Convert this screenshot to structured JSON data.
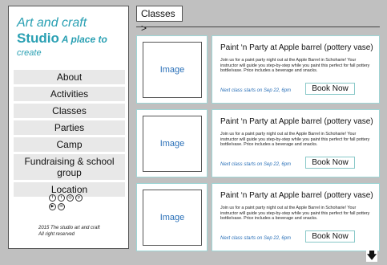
{
  "brand": {
    "line1": "Art and craft",
    "studio": "Studio",
    "tagline": "A place to",
    "tagline2": "create",
    "color": "#2aa0b3"
  },
  "nav": [
    "About",
    "Activities",
    "Classes",
    "Parties",
    "Camp",
    "Fundraising & school group",
    "Location"
  ],
  "social_icons": [
    "facebook-icon",
    "twitter-icon",
    "instagram-icon",
    "pinterest-icon",
    "youtube-icon",
    "email-icon"
  ],
  "footer": {
    "line1": "2015 The studio art and craft",
    "line2": "All right reserved"
  },
  "breadcrumb": "Classes >",
  "cards": [
    {
      "image": "Image",
      "title": "Paint ‘n Party at Apple barrel (pottery vase)",
      "description": "Join us for a paint party night out at the Apple Barrel in Schoharie! Your instructor will guide you step-by-step while you paint this perfect for fall pottery bottle/vase. Price includes a beverage and snacks.",
      "next": "Next class starts on Sep 22, 6pm",
      "button": "Book Now"
    },
    {
      "image": "Image",
      "title": "Paint ‘n Party at Apple barrel (pottery vase)",
      "description": "Join us for a paint party night out at the Apple Barrel in Schoharie! Your instructor will guide you step-by-step while you paint this perfect for fall pottery bottle/vase. Price includes a beverage and snacks.",
      "next": "Next class starts on Sep 22, 6pm",
      "button": "Book Now"
    },
    {
      "image": "Image",
      "title": "Paint ‘n Party at Apple barrel (pottery vase)",
      "description": "Join us for a paint party night out at the Apple Barrel in Schoharie! Your instructor will guide you step-by-step while you paint this perfect for fall pottery bottle/vase. Price includes a beverage and snacks.",
      "next": "Next class starts on Sep 22, 6pm",
      "button": "Book Now"
    }
  ],
  "scroll_icon": "down-arrow-icon"
}
